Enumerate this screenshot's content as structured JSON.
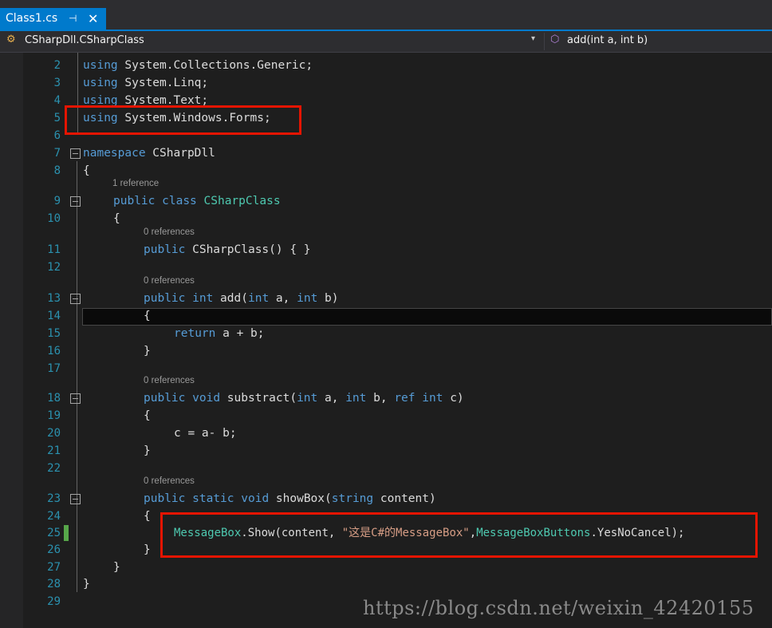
{
  "tab": {
    "title": "Class1.cs",
    "pin": "⊣",
    "close": "✕"
  },
  "navbar": {
    "class_icon": "⚙",
    "class_label": "CSharpDll.CSharpClass",
    "dropdown": "▾",
    "method_icon": "⬡",
    "method_label": "add(int a, int b)"
  },
  "codelens": {
    "class_refs": "1 reference",
    "zero_refs": "0 references"
  },
  "lines": {
    "n2": "2",
    "n3": "3",
    "n4": "4",
    "n5": "5",
    "n6": "6",
    "n7": "7",
    "n8": "8",
    "n9": "9",
    "n10": "10",
    "n11": "11",
    "n12": "12",
    "n13": "13",
    "n14": "14",
    "n15": "15",
    "n16": "16",
    "n17": "17",
    "n18": "18",
    "n19": "19",
    "n20": "20",
    "n21": "21",
    "n22": "22",
    "n23": "23",
    "n24": "24",
    "n25": "25",
    "n26": "26",
    "n27": "27",
    "n28": "28",
    "n29": "29"
  },
  "code": {
    "using": "using",
    "l2_ns": " System.Collections.Generic;",
    "l3_ns": " System.Linq;",
    "l4_ns": " System.Text;",
    "l5_ns": " System.Windows.Forms;",
    "namespace_kw": "namespace",
    "namespace_name": " CSharpDll",
    "open_brace": "{",
    "close_brace": "}",
    "public": "public",
    "class": "class",
    "class_name": "CSharpClass",
    "ctor": " CSharpClass() { }",
    "int": "int",
    "void": "void",
    "static": "static",
    "string": "string",
    "ref": "ref",
    "return": "return",
    "add": " add(",
    "a_comma": " a, ",
    "b_paren": " b)",
    "return_expr": " a + b;",
    "substract": " substract(",
    "b_comma": " b, ",
    "c_paren": " c)",
    "sub_body": "c = a- b;",
    "showbox": " showBox(",
    "content_param": " content)",
    "msgbox_class": "MessageBox",
    "msgbox_call": ".Show(content, ",
    "msgbox_string": "\"这是C#的MessageBox\"",
    "msgbox_comma": ",",
    "buttons_class": "MessageBoxButtons",
    "buttons_tail": ".YesNoCancel);"
  },
  "watermark": "https://blog.csdn.net/weixin_42420155",
  "colors": {
    "keyword": "#569cd6",
    "type": "#4ec9b0",
    "string": "#d69d85",
    "linenum": "#2b91af",
    "accent": "#007acc",
    "highlight": "#e51400"
  }
}
